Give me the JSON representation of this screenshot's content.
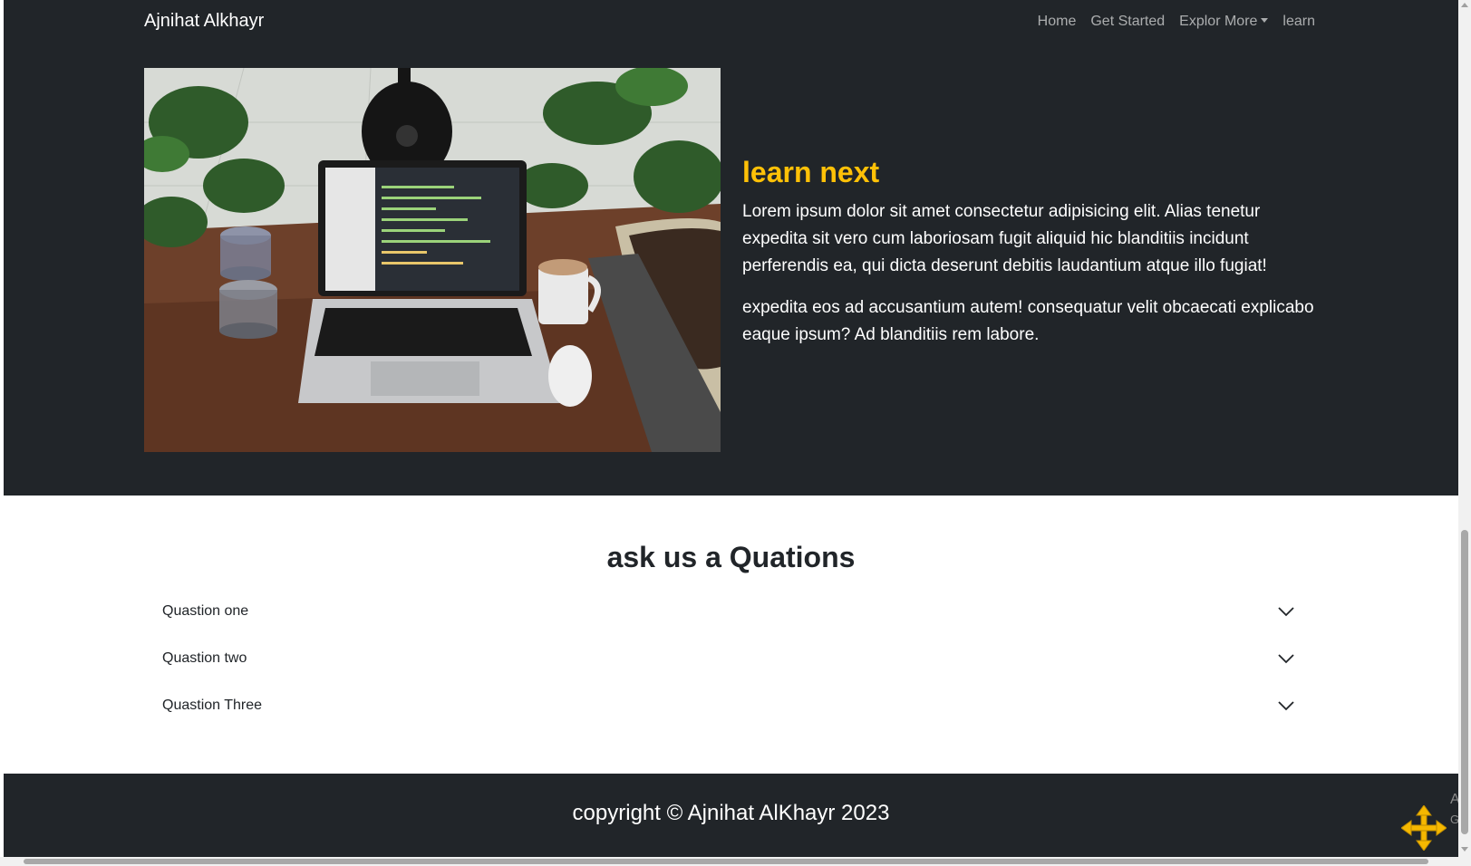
{
  "navbar": {
    "brand": "Ajnihat Alkhayr",
    "links": [
      {
        "label": "Home"
      },
      {
        "label": "Get Started"
      },
      {
        "label": "Explor More"
      },
      {
        "label": "learn"
      }
    ]
  },
  "hero": {
    "image_alt": "laptop on wooden desk with plants, glasses and a coffee mug",
    "title": "learn next",
    "paragraph1": "Lorem ipsum dolor sit amet consectetur adipisicing elit. Alias tenetur expedita sit vero cum laboriosam fugit aliquid hic blanditiis incidunt perferendis ea, qui dicta deserunt debitis laudantium atque illo fugiat!",
    "paragraph2": "expedita eos ad accusantium autem! consequatur velit obcaecati explicabo eaque ipsum? Ad blanditiis rem labore."
  },
  "faq": {
    "title": "ask us a Quations",
    "items": [
      {
        "label": "Quastion one"
      },
      {
        "label": "Quastion two"
      },
      {
        "label": "Quastion Three"
      }
    ]
  },
  "footer": {
    "text": "copyright © Ajnihat AlKhayr 2023"
  },
  "overlay": {
    "side_text_1": "Ac",
    "side_text_2": "Go"
  },
  "colors": {
    "dark_bg": "#212529",
    "accent": "#ffc107",
    "white": "#ffffff"
  }
}
